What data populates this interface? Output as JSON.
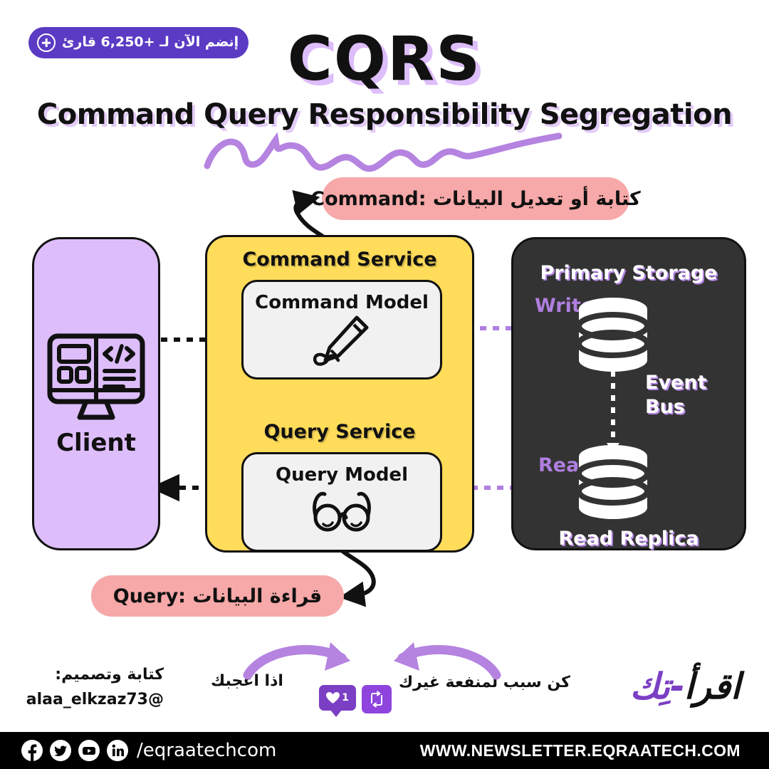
{
  "badge": {
    "text": "إنضم الآن لـ +6,250 قارئ",
    "icon": "plus-circle-icon",
    "bg_color": "#5B3BC4"
  },
  "title": {
    "main": "CQRS",
    "subtitle": "Command Query Responsibility Segregation",
    "shadow_color": "#DDBDFA",
    "underline": "purple-squiggle"
  },
  "diagram": {
    "client": {
      "label": "Client",
      "icon": "monitor-code-icon",
      "bg_color": "#DDBDFA"
    },
    "service": {
      "bg_color": "#FFDC5A",
      "command_service_title": "Command Service",
      "query_service_title": "Query Service",
      "command_model": {
        "title": "Command Model",
        "icon": "pen-signature-icon"
      },
      "query_model": {
        "title": "Query Model",
        "icon": "glasses-icon"
      }
    },
    "storage": {
      "bg_color": "#333333",
      "primary_title": "Primary Storage",
      "replica_title": "Read Replica",
      "event_bus_label": "Event\nBus",
      "write_label": "Write",
      "read_label": "Read",
      "accent_color": "#B07FE0"
    },
    "callouts": {
      "command": "كتابة أو تعديل البيانات  :Command",
      "query": "قراءة البيانات :Query",
      "bg_color": "#F7A8A8"
    }
  },
  "credit": {
    "line1": "كتابة وتصميم:",
    "line2": "@alaa_elkzaz73"
  },
  "cta": {
    "left": "اذا اعجبك",
    "right": "كن سبب لمنفعة غيرك",
    "like_count": "1",
    "like_icon": "heart-icon",
    "repost_icon": "repost-icon"
  },
  "brand": {
    "arabic": "اقرأ",
    "separator": "-",
    "tek": "تِك"
  },
  "footer": {
    "social_icons": [
      "facebook-icon",
      "twitter-icon",
      "youtube-icon",
      "linkedin-icon"
    ],
    "handle": "/eqraatechcom",
    "site": "WWW.NEWSLETTER.EQRAATECH.COM"
  }
}
